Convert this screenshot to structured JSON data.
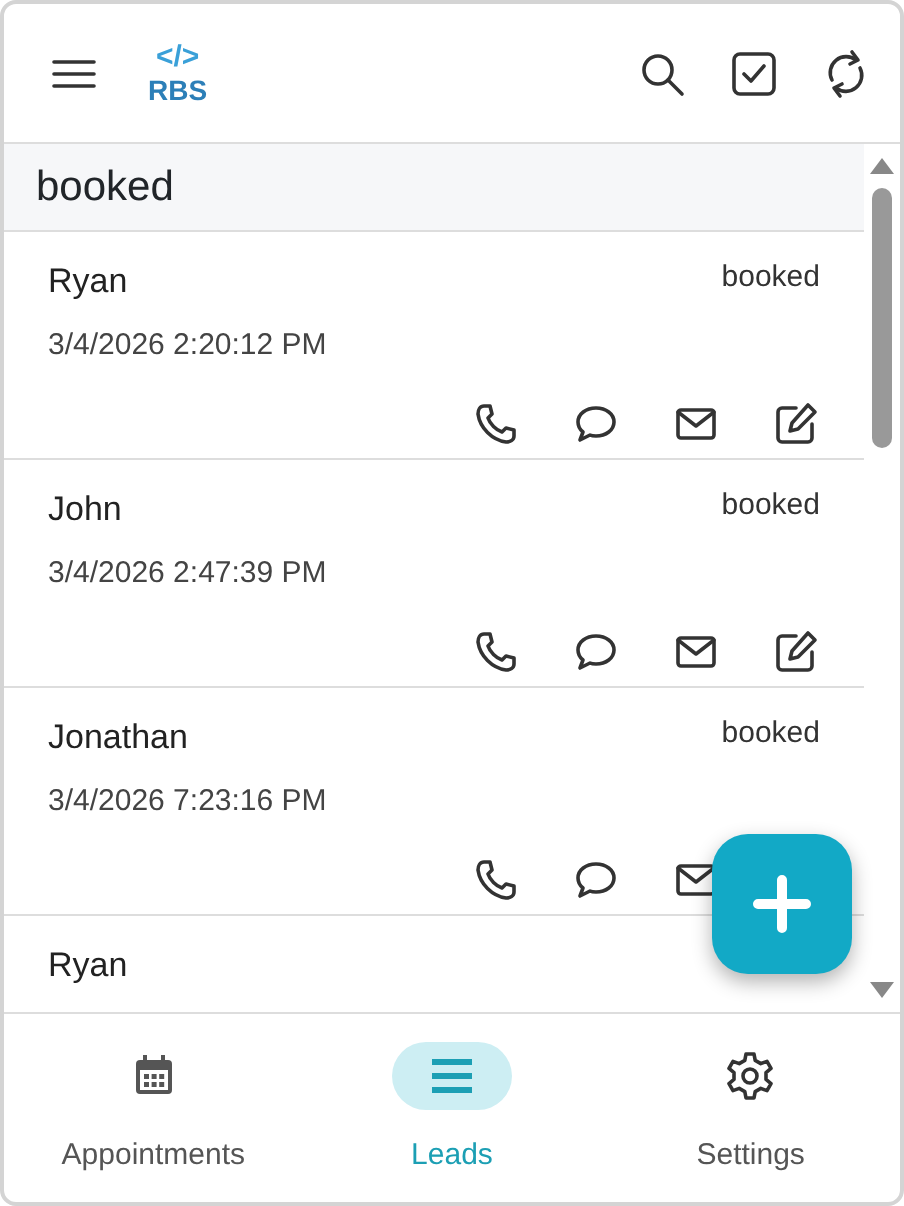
{
  "app_bar": {
    "logo_symbol": "</>",
    "logo_text": "RBS"
  },
  "filter": {
    "label": "booked"
  },
  "leads": [
    {
      "name": "Ryan",
      "status": "booked",
      "datetime": "3/4/2026 2:20:12 PM",
      "actions": [
        {
          "kind": "phone"
        },
        {
          "kind": "message"
        },
        {
          "kind": "email"
        },
        {
          "kind": "edit"
        }
      ]
    },
    {
      "name": "John",
      "status": "booked",
      "datetime": "3/4/2026 2:47:39 PM",
      "actions": [
        {
          "kind": "phone"
        },
        {
          "kind": "message"
        },
        {
          "kind": "email"
        },
        {
          "kind": "edit"
        }
      ]
    },
    {
      "name": "Jonathan",
      "status": "booked",
      "datetime": "3/4/2026 7:23:16 PM",
      "actions": [
        {
          "kind": "phone"
        },
        {
          "kind": "message"
        },
        {
          "kind": "email"
        }
      ]
    },
    {
      "name": "Ryan"
    }
  ],
  "nav": [
    {
      "label": "Appointments",
      "kind": "calendar",
      "selected": false
    },
    {
      "label": "Leads",
      "kind": "list",
      "selected": true
    },
    {
      "label": "Settings",
      "kind": "gear",
      "selected": false
    }
  ]
}
